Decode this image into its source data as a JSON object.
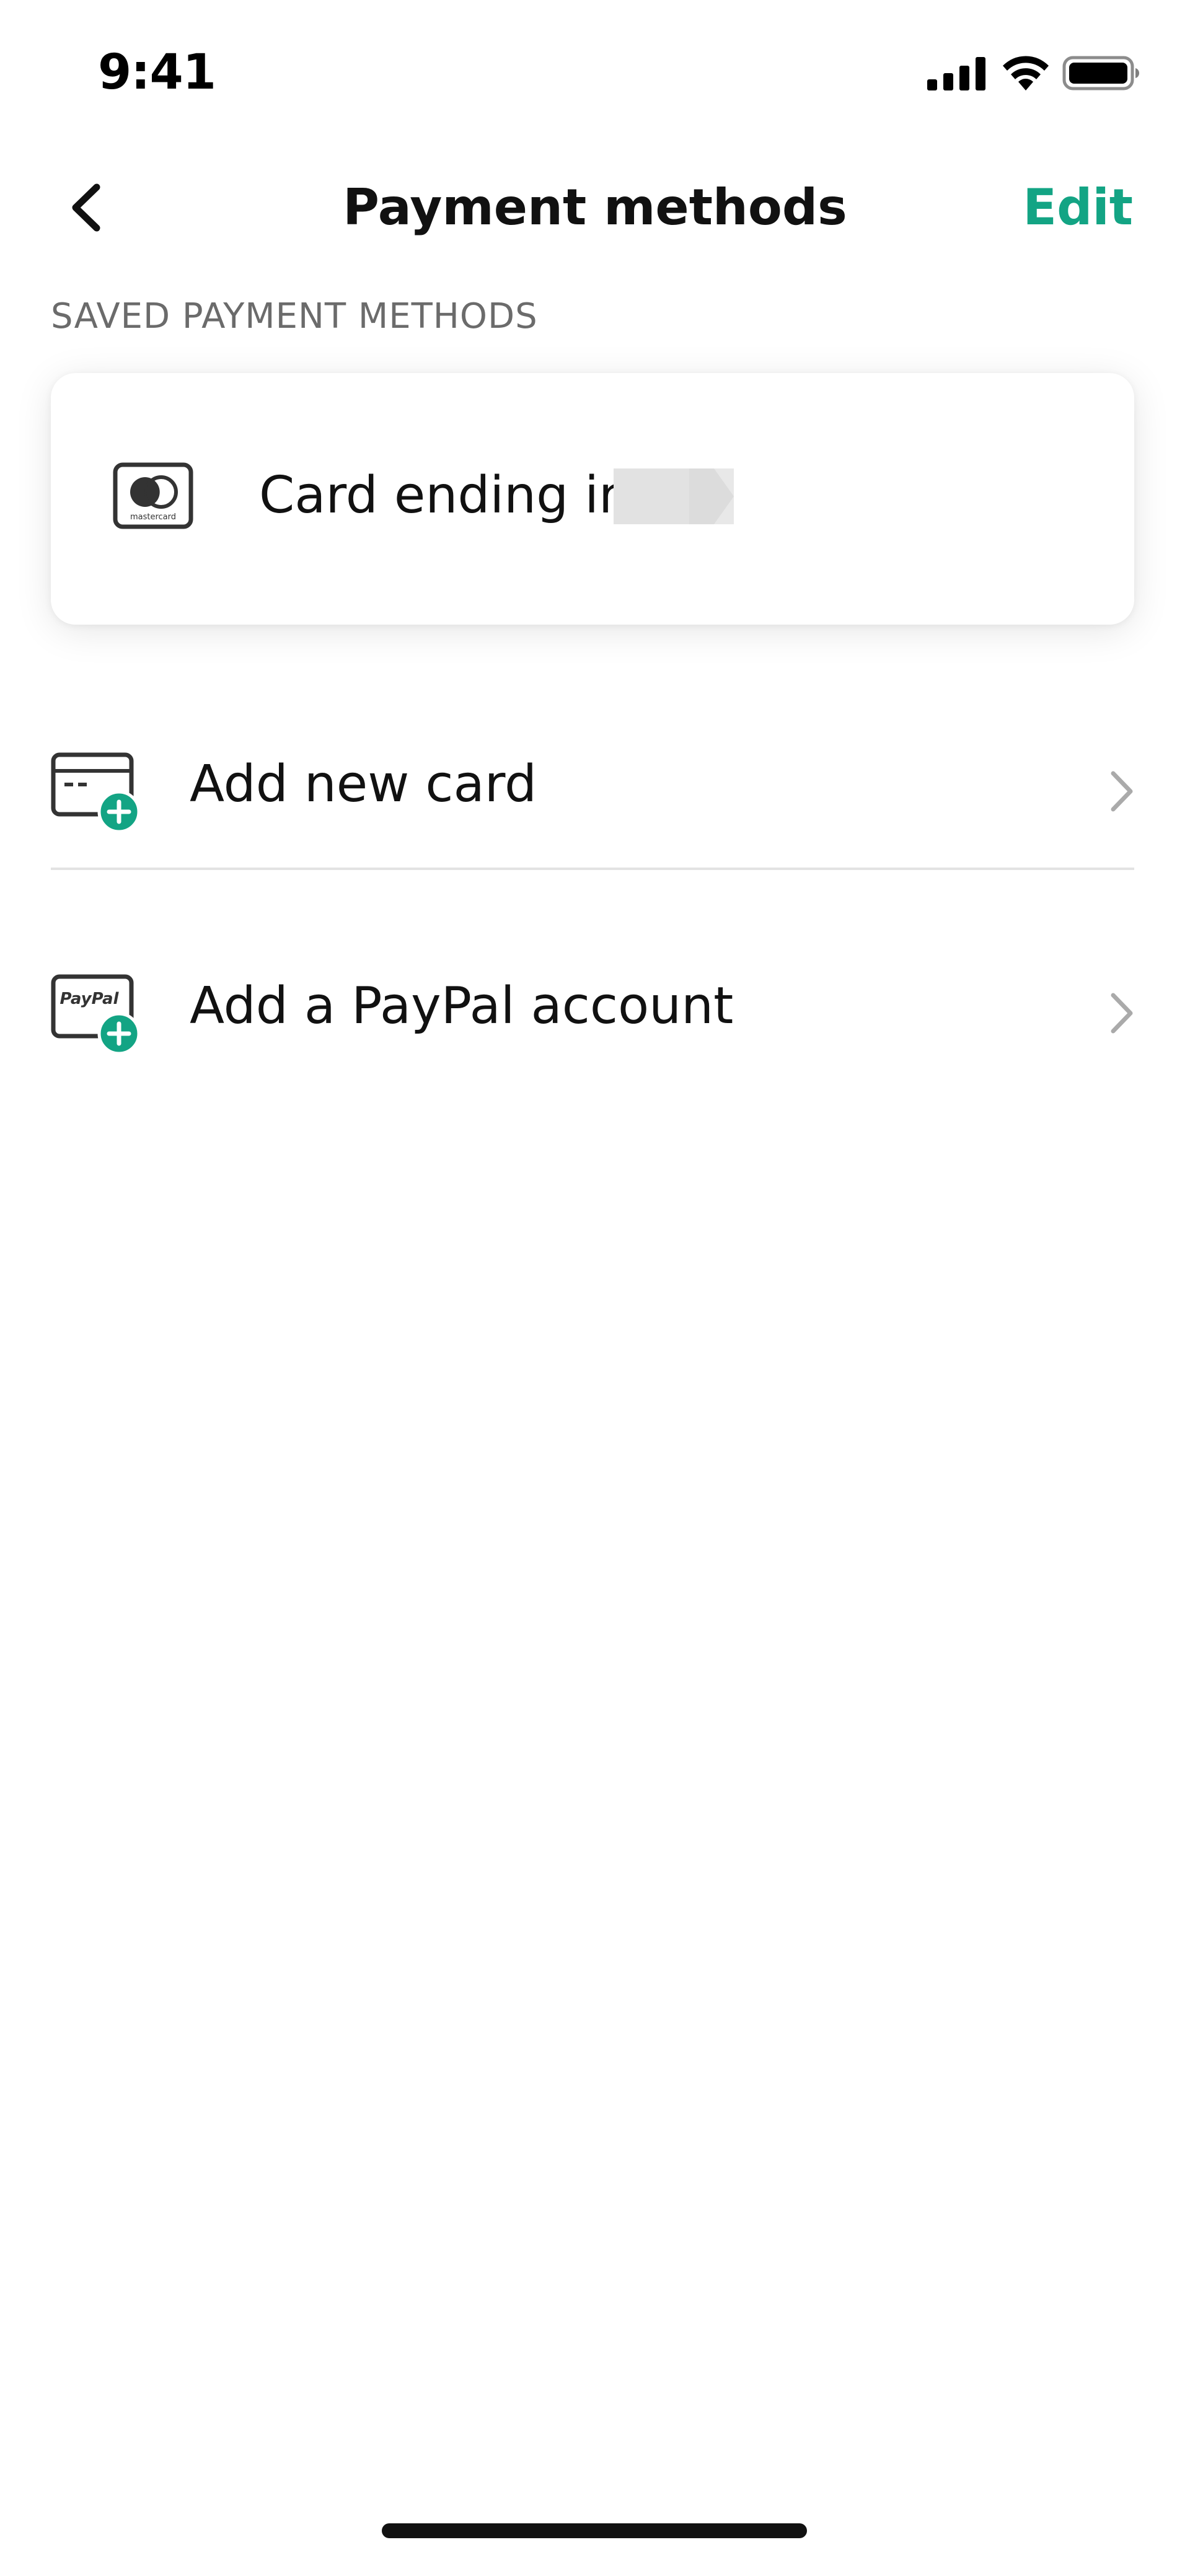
{
  "status_bar": {
    "time": "9:41"
  },
  "nav": {
    "title": "Payment methods",
    "edit_label": "Edit"
  },
  "section": {
    "label": "SAVED PAYMENT METHODS"
  },
  "saved_card": {
    "text": "Card ending in",
    "brand_icon": "mastercard-icon",
    "brand_caption": "mastercard"
  },
  "actions": [
    {
      "label": "Add new card",
      "icon": "add-card-icon"
    },
    {
      "label": "Add a PayPal account",
      "icon": "add-paypal-icon",
      "icon_text": "PayPal"
    }
  ],
  "colors": {
    "accent": "#13a484",
    "text": "#111111",
    "secondary_text": "#6b6b6b",
    "divider": "#e3e3e3"
  }
}
